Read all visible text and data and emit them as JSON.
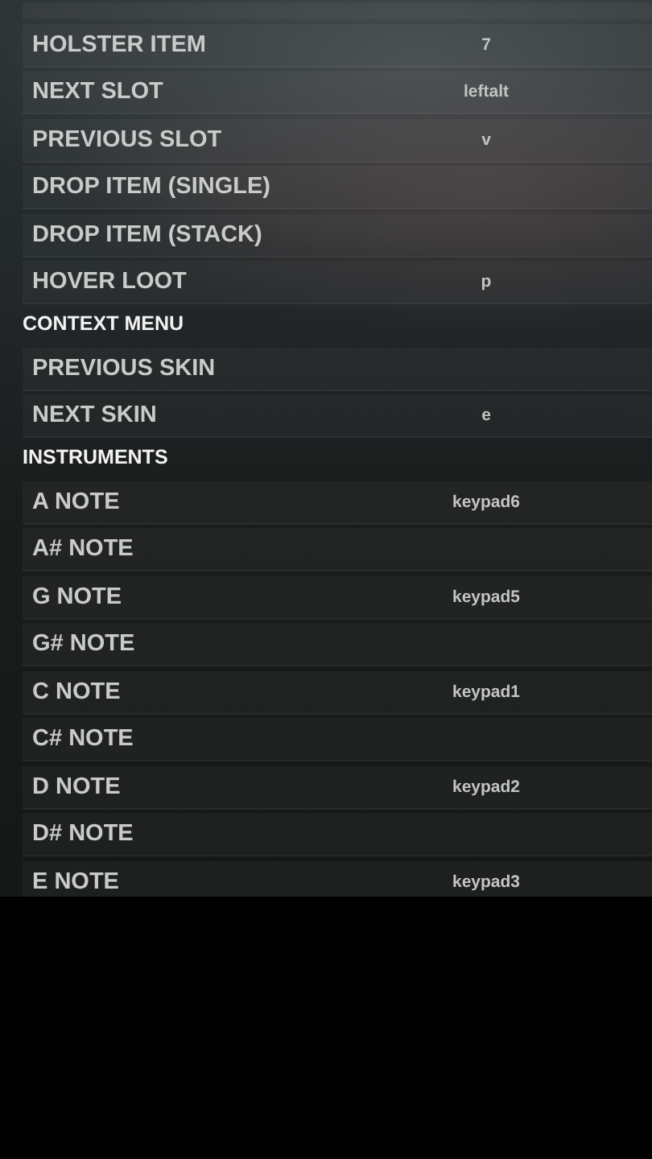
{
  "items": [
    {
      "kind": "binding",
      "label": "HOLSTER ITEM",
      "key": "7"
    },
    {
      "kind": "binding",
      "label": "NEXT SLOT",
      "key": "leftalt"
    },
    {
      "kind": "binding",
      "label": "PREVIOUS SLOT",
      "key": "v"
    },
    {
      "kind": "binding",
      "label": "DROP ITEM (SINGLE)"
    },
    {
      "kind": "binding",
      "label": "DROP ITEM (STACK)"
    },
    {
      "kind": "binding",
      "label": "HOVER LOOT",
      "key": "p"
    },
    {
      "kind": "header",
      "label": "CONTEXT MENU"
    },
    {
      "kind": "binding",
      "label": "PREVIOUS SKIN"
    },
    {
      "kind": "binding",
      "label": "NEXT SKIN",
      "key": "e"
    },
    {
      "kind": "header",
      "label": "INSTRUMENTS"
    },
    {
      "kind": "binding",
      "label": "A NOTE",
      "key": "keypad6"
    },
    {
      "kind": "binding",
      "label": "A# NOTE"
    },
    {
      "kind": "binding",
      "label": "G NOTE",
      "key": "keypad5"
    },
    {
      "kind": "binding",
      "label": "G# NOTE"
    },
    {
      "kind": "binding",
      "label": "C NOTE",
      "key": "keypad1"
    },
    {
      "kind": "binding",
      "label": "C# NOTE"
    },
    {
      "kind": "binding",
      "label": "D NOTE",
      "key": "keypad2"
    },
    {
      "kind": "binding",
      "label": "D# NOTE"
    },
    {
      "kind": "binding",
      "label": "E NOTE",
      "key": "keypad3"
    }
  ]
}
